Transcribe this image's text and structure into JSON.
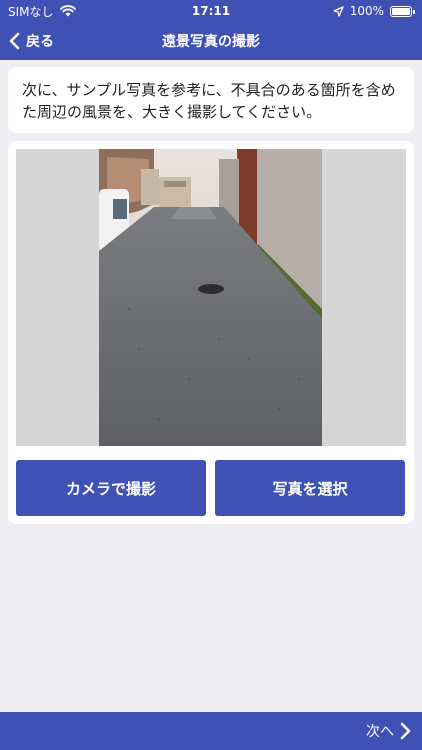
{
  "status": {
    "carrier": "SIMなし",
    "time": "17:11",
    "battery_percent": "100%"
  },
  "nav": {
    "back_label": "戻る",
    "title": "遠景写真の撮影"
  },
  "instruction": {
    "text": "次に、サンプル写真を参考に、不具合のある箇所を含めた周辺の風景を、大きく撮影してください。"
  },
  "actions": {
    "camera_label": "カメラで撮影",
    "select_label": "写真を選択"
  },
  "footer": {
    "next_label": "次へ"
  },
  "colors": {
    "primary": "#3f51b5",
    "background": "#eeeef3"
  },
  "icons": {
    "wifi": "wifi-icon",
    "location": "location-arrow-icon",
    "battery": "battery-icon",
    "back": "chevron-left-icon",
    "next": "chevron-right-icon"
  }
}
